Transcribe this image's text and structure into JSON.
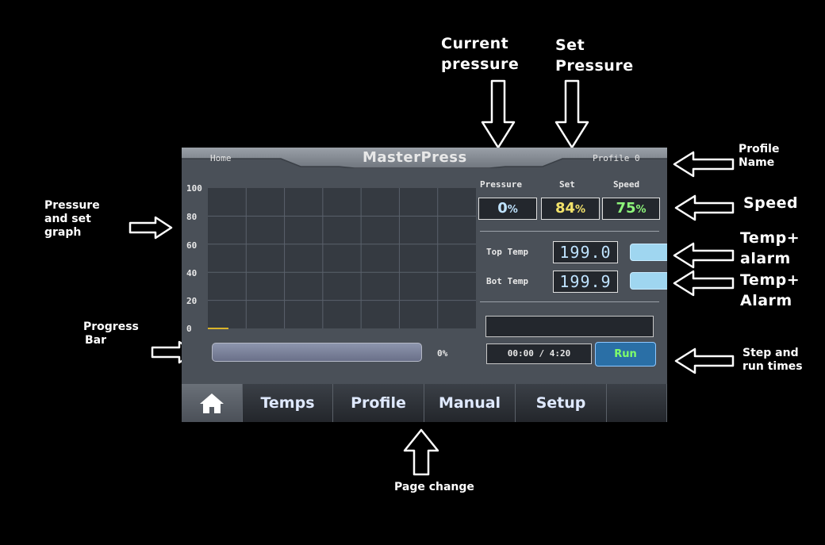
{
  "annotations": {
    "current_pressure": [
      "Current",
      "pressure"
    ],
    "set_pressure": [
      "Set",
      "Pressure"
    ],
    "profile_name": [
      "Profile",
      "Name"
    ],
    "speed": "Speed",
    "temp_alarm_1": [
      "Temp+",
      "alarm"
    ],
    "temp_alarm_2": [
      "Temp+",
      "Alarm"
    ],
    "graph": [
      "Pressure",
      "and set",
      "graph"
    ],
    "progress_bar": [
      "Progress",
      "Bar"
    ],
    "step_run": [
      "Step and",
      "run times"
    ],
    "page_change": "Page change"
  },
  "screen": {
    "home_label": "Home",
    "app_title": "MasterPress",
    "profile_name": "Profile 0",
    "graph": {
      "y_ticks": [
        "100",
        "80",
        "60",
        "40",
        "20",
        "0"
      ],
      "grid_cols": 7,
      "grid_rows": 5,
      "y_range": [
        0,
        100
      ]
    },
    "progress": {
      "value_percent": 0,
      "label": "0%"
    },
    "headers": {
      "pressure": "Pressure",
      "set": "Set",
      "speed": "Speed"
    },
    "values": {
      "pressure": {
        "number": "0",
        "unit": "%",
        "color": "#bfe3ff"
      },
      "set": {
        "number": "84",
        "unit": "%",
        "color": "#f3e36a"
      },
      "speed": {
        "number": "75",
        "unit": "%",
        "color": "#8df57a"
      }
    },
    "temps": {
      "top_label": "Top Temp",
      "top_value": "199.0",
      "bot_label": "Bot Temp",
      "bot_value": "199.9"
    },
    "step_text": "",
    "time_text": "00:00 / 4:20",
    "run_label": "Run",
    "tabs": [
      {
        "label": "",
        "icon": "home-icon",
        "active": true
      },
      {
        "label": "Temps",
        "active": false
      },
      {
        "label": "Profile",
        "active": false
      },
      {
        "label": "Manual",
        "active": false
      },
      {
        "label": "Setup",
        "active": false
      },
      {
        "label": "",
        "active": false
      }
    ],
    "colors": {
      "accent": "#7fff6a",
      "panel": "#4a5058",
      "run_button": "#2a6fa6"
    }
  }
}
